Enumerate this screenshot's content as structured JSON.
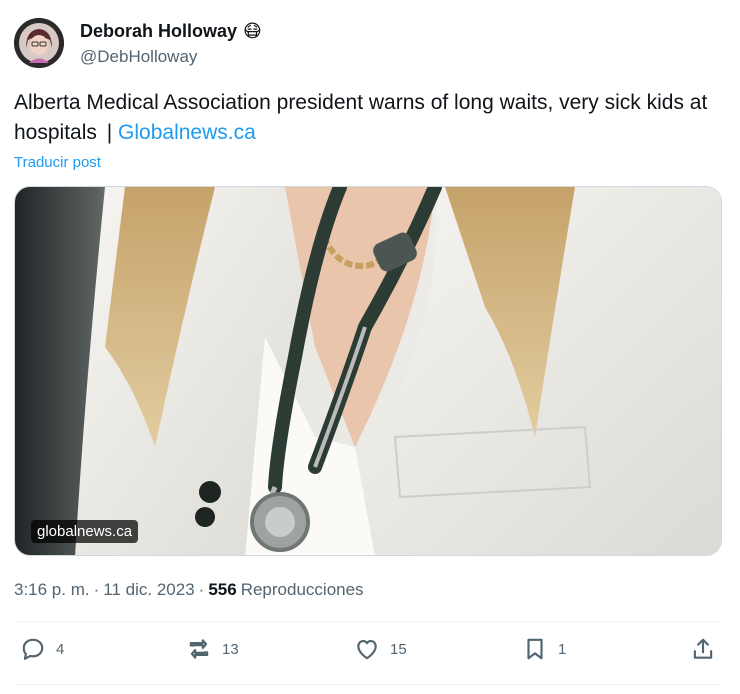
{
  "author": {
    "display_name": "Deborah Holloway",
    "emoji": "😷",
    "handle": "@DebHolloway",
    "avatar_icon": "avatar"
  },
  "tweet": {
    "text": "Alberta Medical Association president warns of long waits, very sick kids at hospitals ",
    "separator": "|",
    "link_text": "Globalnews.ca",
    "translate_label": "Traducir post"
  },
  "media": {
    "domain": "globalnews.ca",
    "image_description_icon": "doctor-stethoscope-image"
  },
  "meta": {
    "time": "3:16 p. m.",
    "dot1": "·",
    "date": "11 dic. 2023",
    "dot2": "·",
    "views_count": "556",
    "views_label": "Reproducciones"
  },
  "actions": {
    "reply_count": "4",
    "retweet_count": "13",
    "like_count": "15",
    "bookmark_count": "1"
  },
  "colors": {
    "link": "#1d9bf0",
    "muted": "#536471",
    "text": "#0f1419"
  }
}
